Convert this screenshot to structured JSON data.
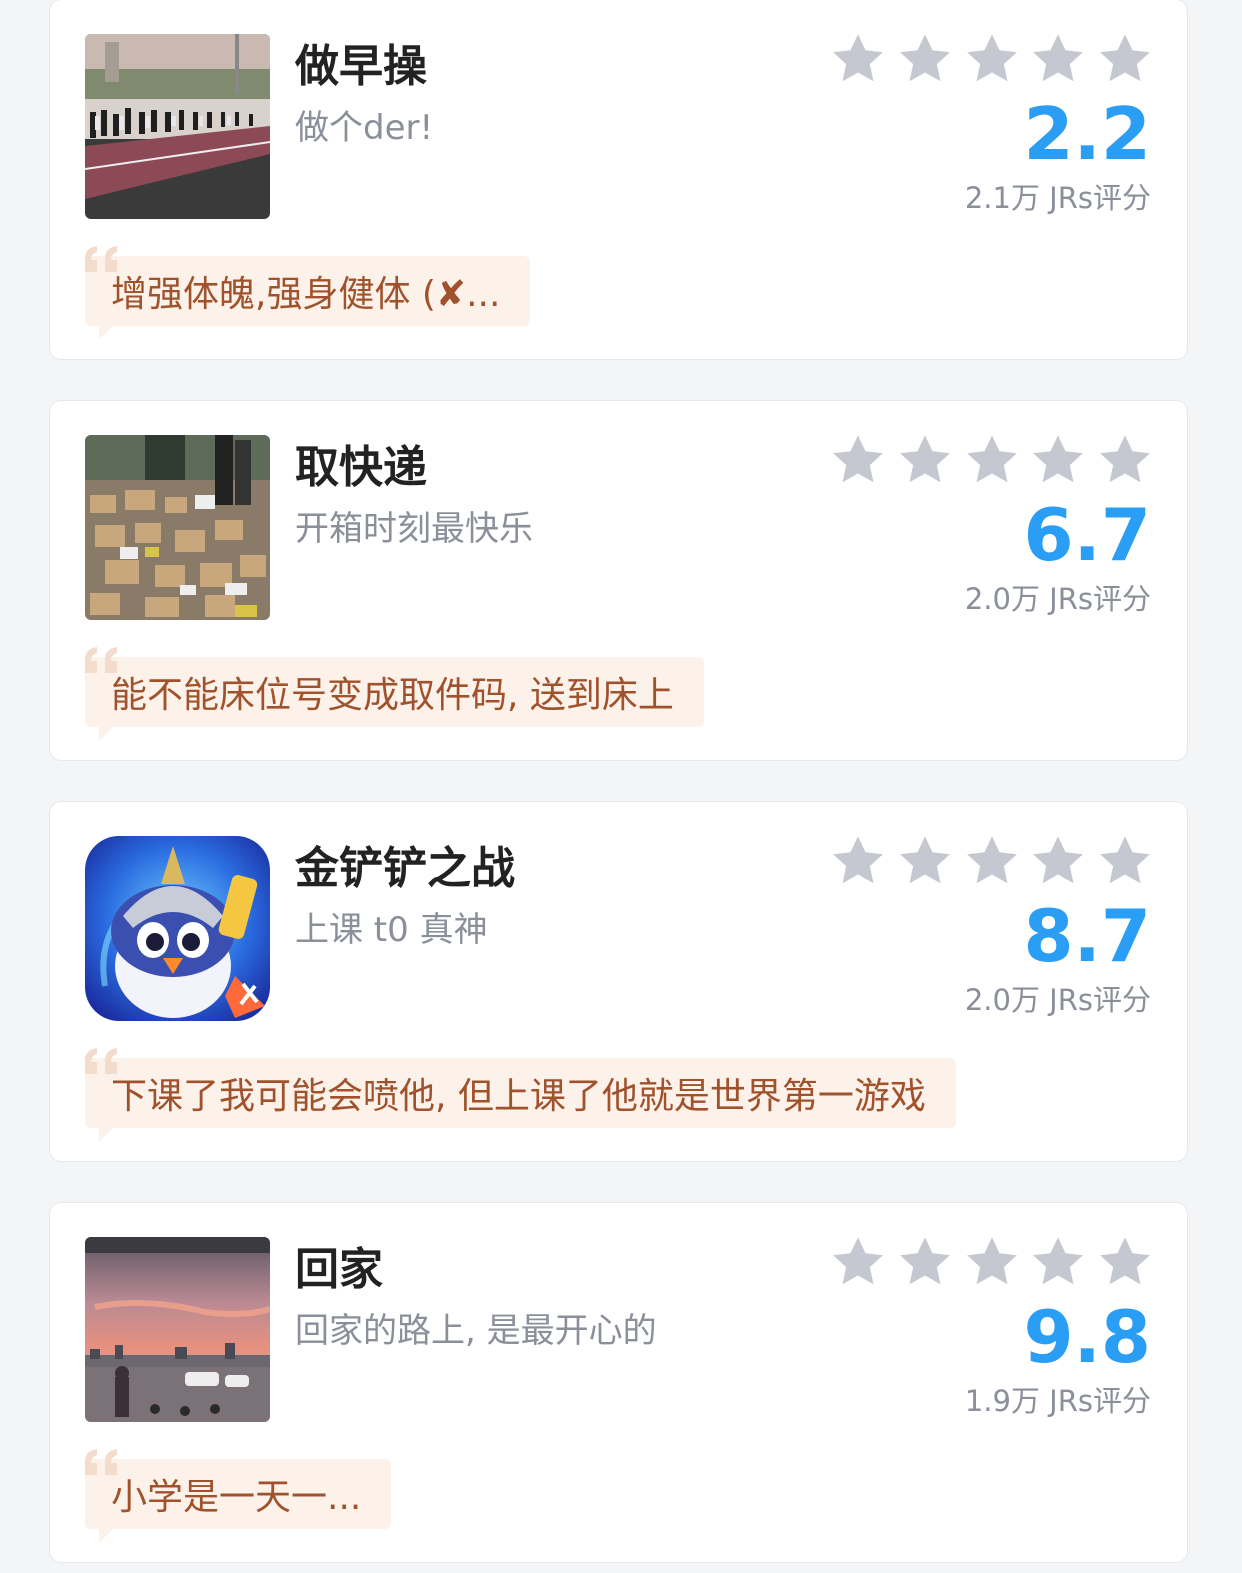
{
  "colors": {
    "score": "#2a9df4",
    "star": "#c5c8d0",
    "comment_bg": "#fcf2ea",
    "comment_text": "#a0522d"
  },
  "cards": [
    {
      "title": "做早操",
      "subtitle": "做个der!",
      "score": "2.2",
      "count": "2.1万 JRs评分",
      "comment": "增强体魄,强身健体 (✘...",
      "thumb": "morning-exercise-photo"
    },
    {
      "title": "取快递",
      "subtitle": "开箱时刻最快乐",
      "score": "6.7",
      "count": "2.0万 JRs评分",
      "comment": "能不能床位号变成取件码, 送到床上",
      "thumb": "parcels-photo"
    },
    {
      "title": "金铲铲之战",
      "subtitle": "上课 t0 真神",
      "score": "8.7",
      "count": "2.0万 JRs评分",
      "comment": "下课了我可能会喷他, 但上课了他就是世界第一游戏",
      "thumb": "game-app-icon"
    },
    {
      "title": "回家",
      "subtitle": "回家的路上, 是最开心的",
      "score": "9.8",
      "count": "1.9万 JRs评分",
      "comment": "小学是一天一...",
      "thumb": "sunset-photo"
    }
  ]
}
